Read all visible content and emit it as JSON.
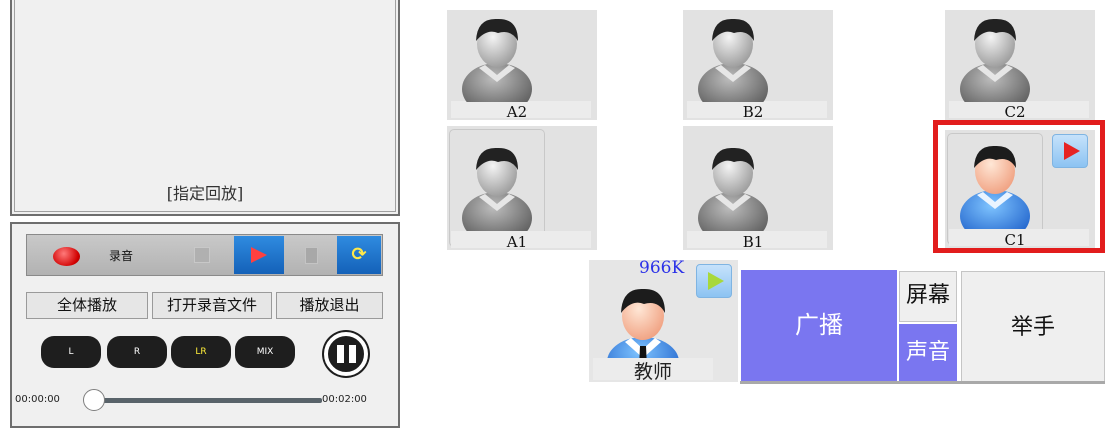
{
  "left_panel": {
    "replay_label": "[指定回放]",
    "record_label": "录音",
    "buttons": [
      "全体播放",
      "打开录音文件",
      "播放退出"
    ],
    "channels": [
      "L",
      "R",
      "LR",
      "MIX"
    ],
    "active_channel": "LR",
    "time_start": "00:00:00",
    "time_end": "00:02:00",
    "playback_progress": 0.0
  },
  "students": [
    {
      "id": "A2",
      "label": "A2"
    },
    {
      "id": "B2",
      "label": "B2"
    },
    {
      "id": "C2",
      "label": "C2"
    },
    {
      "id": "A1",
      "label": "A1"
    },
    {
      "id": "B1",
      "label": "B1"
    },
    {
      "id": "C1",
      "label": "C1",
      "active": true
    }
  ],
  "teacher": {
    "bitrate": "966K",
    "label": "教师"
  },
  "controls": {
    "broadcast": "广播",
    "screen": "屏幕",
    "sound": "声音",
    "raise_hand": "举手"
  },
  "colors": {
    "accent_purple": "#7a76f0",
    "highlight_red": "#e21d1d",
    "bitrate_blue": "#2b31e8",
    "toolbar_blue": "#2f8be0"
  }
}
